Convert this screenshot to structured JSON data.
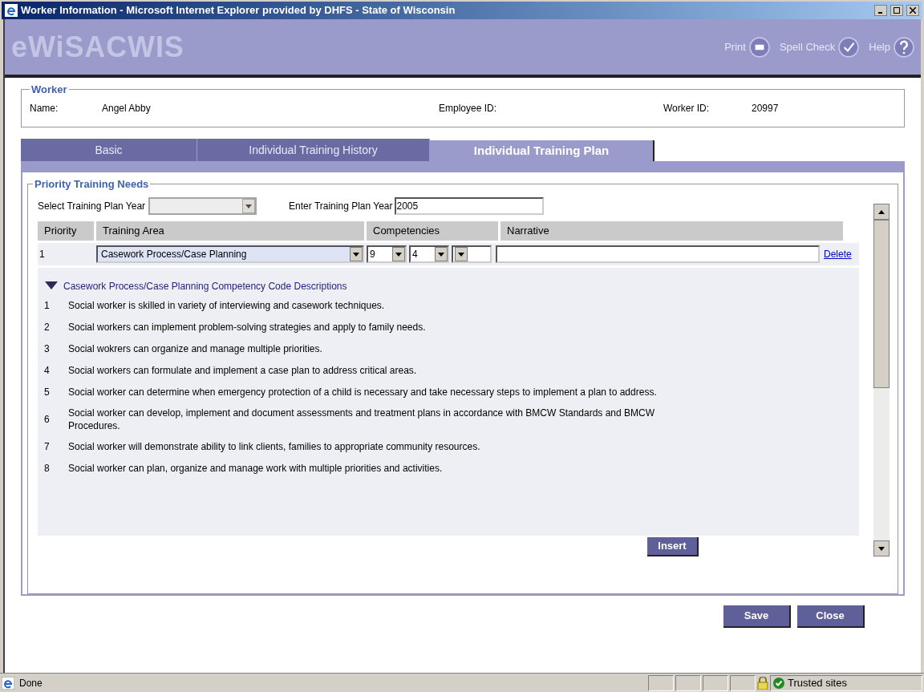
{
  "window": {
    "title": "Worker Information - Microsoft Internet Explorer provided by DHFS - State of Wisconsin"
  },
  "header": {
    "logo": "eWiSACWIS",
    "actions": [
      {
        "label": "Print",
        "kind": "print"
      },
      {
        "label": "Spell Check",
        "kind": "spell"
      },
      {
        "label": "Help",
        "kind": "help"
      }
    ]
  },
  "worker": {
    "legend": "Worker",
    "fields": [
      {
        "label": "Name:",
        "value": "Angel Abby"
      },
      {
        "label": "Employee ID:"
      },
      {
        "label": "Worker ID:",
        "value": "20997"
      }
    ]
  },
  "tabs": [
    {
      "label": "Basic",
      "selected": false
    },
    {
      "label": "Individual Training History",
      "selected": false
    },
    {
      "label": "Individual Training Plan",
      "selected": true
    }
  ],
  "priority_training_needs": {
    "legend": "Priority Training Needs",
    "select_year_label": "Select Training Plan Year",
    "select_year_disabled": true,
    "enter_year_label": "Enter Training Plan Year",
    "enter_year_value": "2005",
    "table": {
      "columns": [
        "Priority",
        "Training Area",
        "Competencies",
        "Narrative"
      ],
      "rows": [
        {
          "priority": "1",
          "training_area": "Casework Process/Case Planning",
          "competencies": [
            "9",
            "4"
          ],
          "narrative": "",
          "action": "Delete"
        }
      ]
    },
    "descriptions_title": "Casework Process/Case Planning Competency Code Descriptions",
    "expanded": true,
    "descriptions": [
      {
        "code": "1",
        "text": "Social worker is skilled in variety of interviewing and casework techniques."
      },
      {
        "code": "2",
        "text": "Social workers can implement problem-solving strategies and apply to family needs."
      },
      {
        "code": "3",
        "text": "Social wokrers can organize and manage multiple priorities."
      },
      {
        "code": "4",
        "text": "Social workers can formulate and implement a case plan to address critical areas."
      },
      {
        "code": "5",
        "text": "Social worker can determine when emergency protection of a child is necessary and take necessary steps to implement a plan to address."
      },
      {
        "code": "6",
        "text": "Social worker can develop, implement and document assessments and treatment plans in accordance with BMCW Standards and BMCW Procedures."
      },
      {
        "code": "7",
        "text": "Social worker will demonstrate ability to link clients, families to appropriate community resources."
      },
      {
        "code": "8",
        "text": "Social worker can plan, organize and manage work with multiple priorities and activities."
      }
    ],
    "insert_button": "Insert"
  },
  "buttons": [
    "Save",
    "Close"
  ],
  "status_bar": {
    "text": "Done",
    "zone": "Trusted sites"
  }
}
